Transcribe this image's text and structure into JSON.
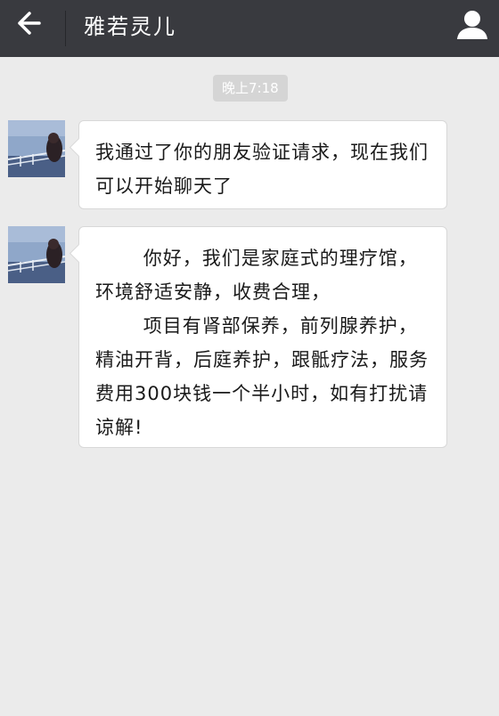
{
  "header": {
    "title": "雅若灵儿",
    "back_icon": "back-arrow-icon",
    "profile_icon": "person-icon"
  },
  "timestamp": "晚上7:18",
  "messages": [
    {
      "sender": "other",
      "avatar_icon": "avatar-photo",
      "text": "我通过了你的朋友验证请求，现在我们可以开始聊天了"
    },
    {
      "sender": "other",
      "avatar_icon": "avatar-photo",
      "text": "       你好，我们是家庭式的理疗馆，环境舒适安静，收费合理，\n       项目有肾部保养，前列腺养护，精油开背，后庭养护，跟骶疗法，服务费用300块钱一个半小时，如有打扰请谅解!"
    }
  ],
  "colors": {
    "header_bg": "#393a3f",
    "chat_bg": "#ebebeb",
    "bubble_bg": "#ffffff",
    "timestamp_bg": "#d5d5d5"
  }
}
